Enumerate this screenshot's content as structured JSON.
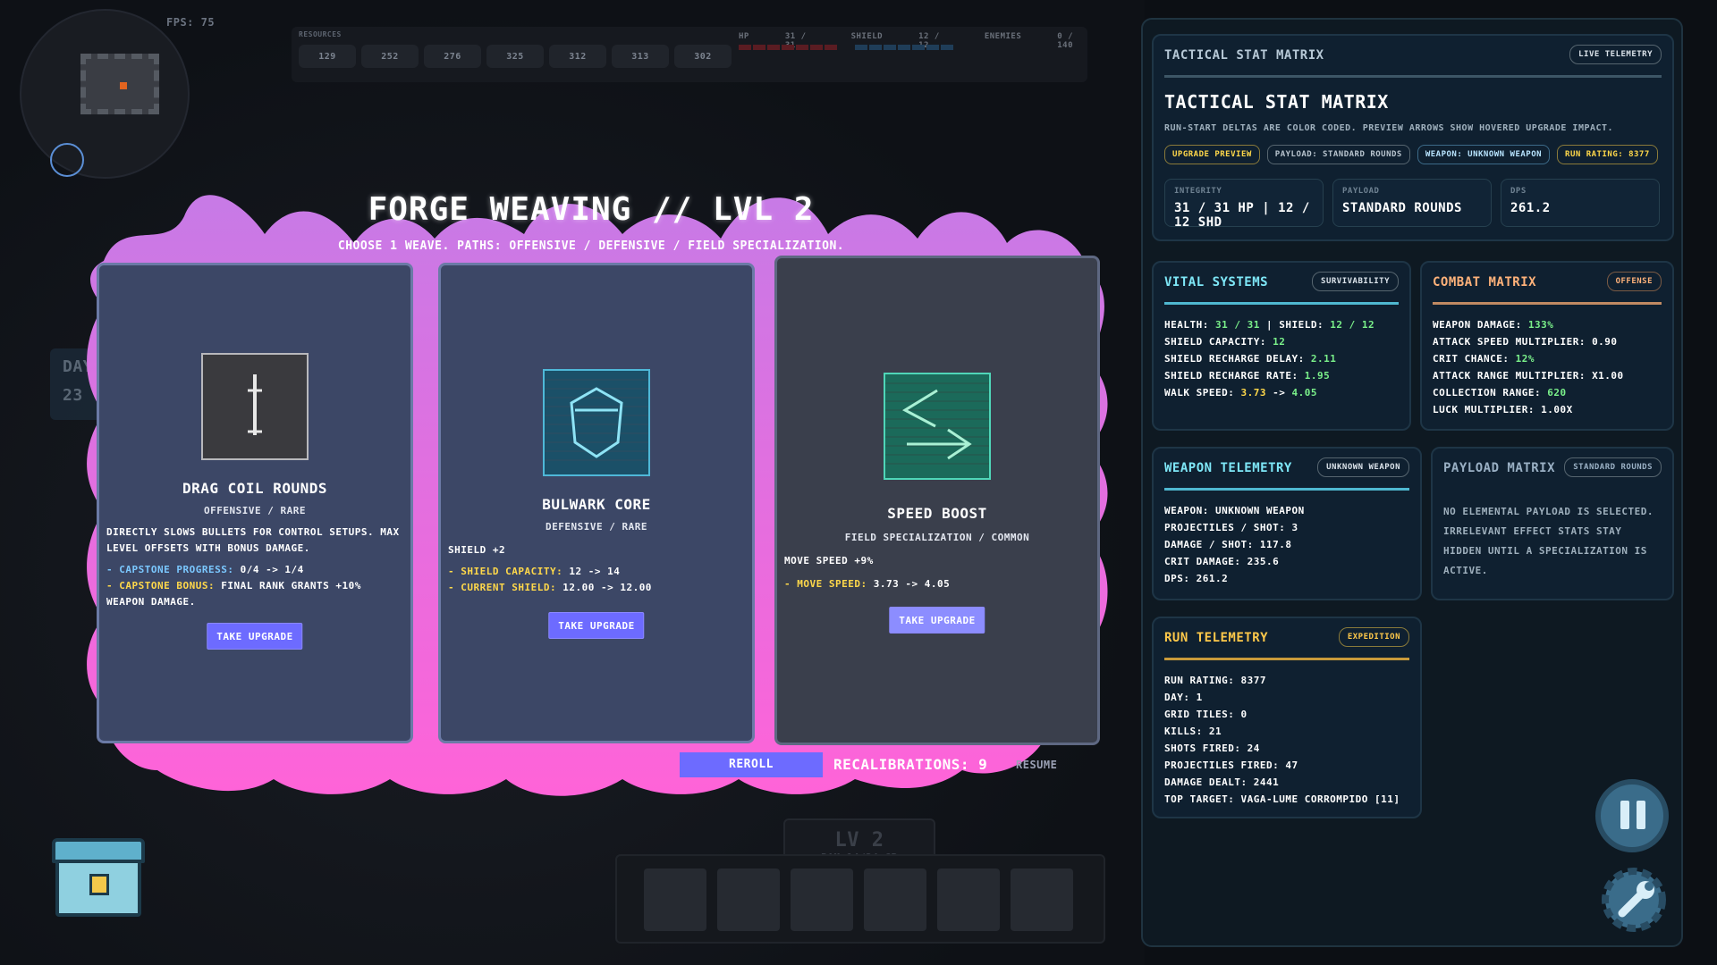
{
  "hud": {
    "fps": "FPS: 75",
    "resources_title": "RESOURCES",
    "resources": [
      "129",
      "252",
      "276",
      "325",
      "312",
      "313",
      "302"
    ],
    "hp_label": "HP",
    "hp_value": "31 / 31",
    "shield_label": "SHIELD",
    "shield_value": "12 / 12",
    "enemies_label": "ENEMIES",
    "enemies_value": "0 / 140",
    "day_label": "Day",
    "day_value": "23",
    "level": "LV 2",
    "ram": "RAM 14/24 GB"
  },
  "forge": {
    "title": "FORGE WEAVING // LVL 2",
    "subtitle": "CHOOSE 1 WEAVE. PATHS: OFFENSIVE / DEFENSIVE / FIELD SPECIALIZATION.",
    "cards": [
      {
        "name": "DRAG COIL ROUNDS",
        "meta": "OFFENSIVE / RARE",
        "desc": "DIRECTLY SLOWS BULLETS FOR CONTROL SETUPS. MAX LEVEL OFFSETS WITH BONUS DAMAGE.",
        "line1_label": "- CAPSTONE PROGRESS:",
        "line1_value": "0/4 -> 1/4",
        "line2_label": "- CAPSTONE BONUS:",
        "line2_value": "FINAL RANK GRANTS +10% WEAPON DAMAGE.",
        "button": "TAKE UPGRADE"
      },
      {
        "name": "BULWARK CORE",
        "meta": "DEFENSIVE / RARE",
        "desc": "SHIELD +2",
        "line1_label": "- SHIELD CAPACITY:",
        "line1_value": "12 -> 14",
        "line2_label": "- CURRENT SHIELD:",
        "line2_value": "12.00 -> 12.00",
        "button": "TAKE UPGRADE"
      },
      {
        "name": "SPEED BOOST",
        "meta": "FIELD SPECIALIZATION / COMMON",
        "desc": "MOVE SPEED +9%",
        "line1_label": "- MOVE SPEED:",
        "line1_value": "3.73 -> 4.05",
        "button": "TAKE UPGRADE"
      }
    ],
    "reroll": "REROLL",
    "recalibrations": "RECALIBRATIONS: 9",
    "resume": "RESUME"
  },
  "panel": {
    "header": "TACTICAL STAT MATRIX",
    "live_tag": "LIVE TELEMETRY",
    "title": "TACTICAL STAT MATRIX",
    "desc": "RUN-START DELTAS ARE COLOR CODED. PREVIEW ARROWS SHOW HOVERED UPGRADE IMPACT.",
    "chips": [
      "UPGRADE PREVIEW",
      "PAYLOAD: STANDARD ROUNDS",
      "WEAPON: UNKNOWN WEAPON",
      "RUN RATING: 8377"
    ],
    "integrity_label": "INTEGRITY",
    "integrity_value": "31 / 31 HP | 12 / 12 SHD",
    "payload_label": "PAYLOAD",
    "payload_value": "STANDARD ROUNDS",
    "dps_label": "DPS",
    "dps_value": "261.2",
    "vital": {
      "title": "VITAL SYSTEMS",
      "tag": "SURVIVABILITY",
      "health_label": "HEALTH:",
      "health_value": "31 / 31",
      "shield_label": "| SHIELD:",
      "shield_value": "12 / 12",
      "cap_label": "SHIELD CAPACITY:",
      "cap_value": "12",
      "delay_label": "SHIELD RECHARGE DELAY:",
      "delay_value": "2.11",
      "rate_label": "SHIELD RECHARGE RATE:",
      "rate_value": "1.95",
      "walk_label": "WALK SPEED:",
      "walk_from": "3.73",
      "walk_arrow": "->",
      "walk_to": "4.05"
    },
    "combat": {
      "title": "COMBAT MATRIX",
      "tag": "OFFENSE",
      "dmg_label": "WEAPON DAMAGE:",
      "dmg_value": "133%",
      "atk_speed": "ATTACK SPEED MULTIPLIER: 0.90",
      "crit_label": "CRIT CHANCE:",
      "crit_value": "12%",
      "atk_range": "ATTACK RANGE MULTIPLIER: X1.00",
      "coll_label": "COLLECTION RANGE:",
      "coll_value": "620",
      "luck": "LUCK MULTIPLIER: 1.00X"
    },
    "weapon": {
      "title": "WEAPON TELEMETRY",
      "tag": "UNKNOWN WEAPON",
      "rows": [
        "WEAPON: UNKNOWN WEAPON",
        "PROJECTILES / SHOT: 3",
        "DAMAGE / SHOT: 117.8",
        "CRIT DAMAGE: 235.6",
        "DPS: 261.2"
      ]
    },
    "payload": {
      "title": "PAYLOAD MATRIX",
      "tag": "STANDARD ROUNDS",
      "text": "NO ELEMENTAL PAYLOAD IS SELECTED. IRRELEVANT EFFECT STATS STAY HIDDEN UNTIL A SPECIALIZATION IS ACTIVE."
    },
    "run": {
      "title": "RUN TELEMETRY",
      "tag": "EXPEDITION",
      "rows": [
        "RUN RATING: 8377",
        "DAY: 1",
        "GRID TILES: 0",
        "KILLS: 21",
        "SHOTS FIRED: 24",
        "PROJECTILES FIRED: 47",
        "DAMAGE DEALT: 2441",
        "TOP TARGET: VAGA-LUME CORROMPIDO [11]"
      ]
    }
  },
  "colors": {
    "accent_purple": "#6d6bff",
    "splat_top": "#c77ae6",
    "splat_bottom": "#ff63d8",
    "vital_title": "#7ee7f7",
    "combat_title": "#ffb27a",
    "weapon_title": "#7ee7f7",
    "payload_title": "#9ab0c4",
    "run_title": "#ffc94a"
  },
  "icons": [
    "pause-icon",
    "wrench-icon",
    "chest-icon",
    "crosshair-icon"
  ]
}
